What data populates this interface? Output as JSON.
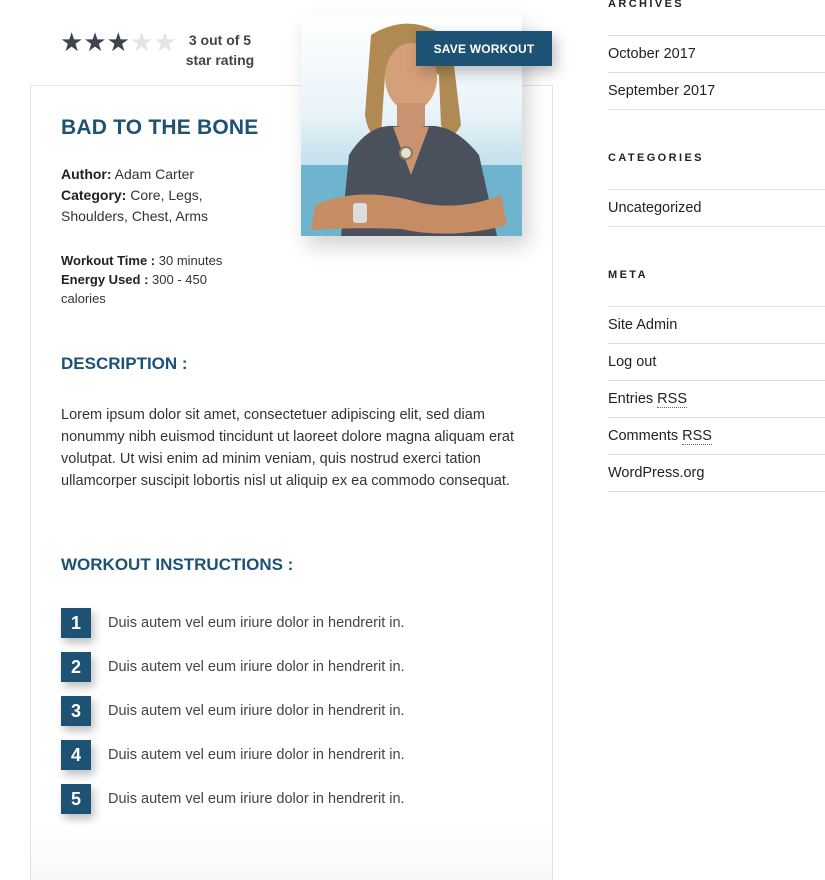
{
  "rating": {
    "value": 3,
    "max": 5,
    "label_line1": "3 out of 5",
    "label_line2": "star rating"
  },
  "workout": {
    "title": "BAD TO THE BONE",
    "author_label": "Author:",
    "author": "Adam Carter",
    "category_label": "Category:",
    "category": "Core, Legs, Shoulders, Chest, Arms",
    "time_label": "Workout Time :",
    "time": "30 minutes",
    "energy_label": "Energy Used :",
    "energy": "300 - 450 calories",
    "save_button": "SAVE WORKOUT",
    "description_heading": "DESCRIPTION :",
    "description": "Lorem ipsum dolor sit amet, consectetuer adipiscing elit, sed diam nonummy nibh euismod tincidunt ut laoreet dolore magna aliquam erat volutpat. Ut wisi enim ad minim veniam, quis nostrud exerci tation ullamcorper suscipit lobortis nisl ut aliquip ex ea commodo consequat.",
    "instructions_heading": "WORKOUT INSTRUCTIONS :",
    "steps": [
      {
        "num": "1",
        "text": "Duis autem vel eum iriure dolor in hendrerit in."
      },
      {
        "num": "2",
        "text": "Duis autem vel eum iriure dolor in hendrerit in."
      },
      {
        "num": "3",
        "text": "Duis autem vel eum iriure dolor in hendrerit in."
      },
      {
        "num": "4",
        "text": "Duis autem vel eum iriure dolor in hendrerit in."
      },
      {
        "num": "5",
        "text": "Duis autem vel eum iriure dolor in hendrerit in."
      }
    ]
  },
  "sidebar": {
    "archives": {
      "title": "ARCHIVES",
      "items": [
        "October 2017",
        "September 2017"
      ]
    },
    "categories": {
      "title": "CATEGORIES",
      "items": [
        "Uncategorized"
      ]
    },
    "meta": {
      "title": "META",
      "site_admin": "Site Admin",
      "log_out": "Log out",
      "entries_prefix": "Entries ",
      "entries_abbr": "RSS",
      "comments_prefix": "Comments ",
      "comments_abbr": "RSS",
      "wordpress": "WordPress.org"
    }
  },
  "colors": {
    "accent": "#1d5274",
    "star_filled": "#3d4450",
    "star_empty": "#e4e4e4"
  },
  "icons": {
    "star_filled": "star-filled-icon",
    "star_empty": "star-empty-icon"
  }
}
